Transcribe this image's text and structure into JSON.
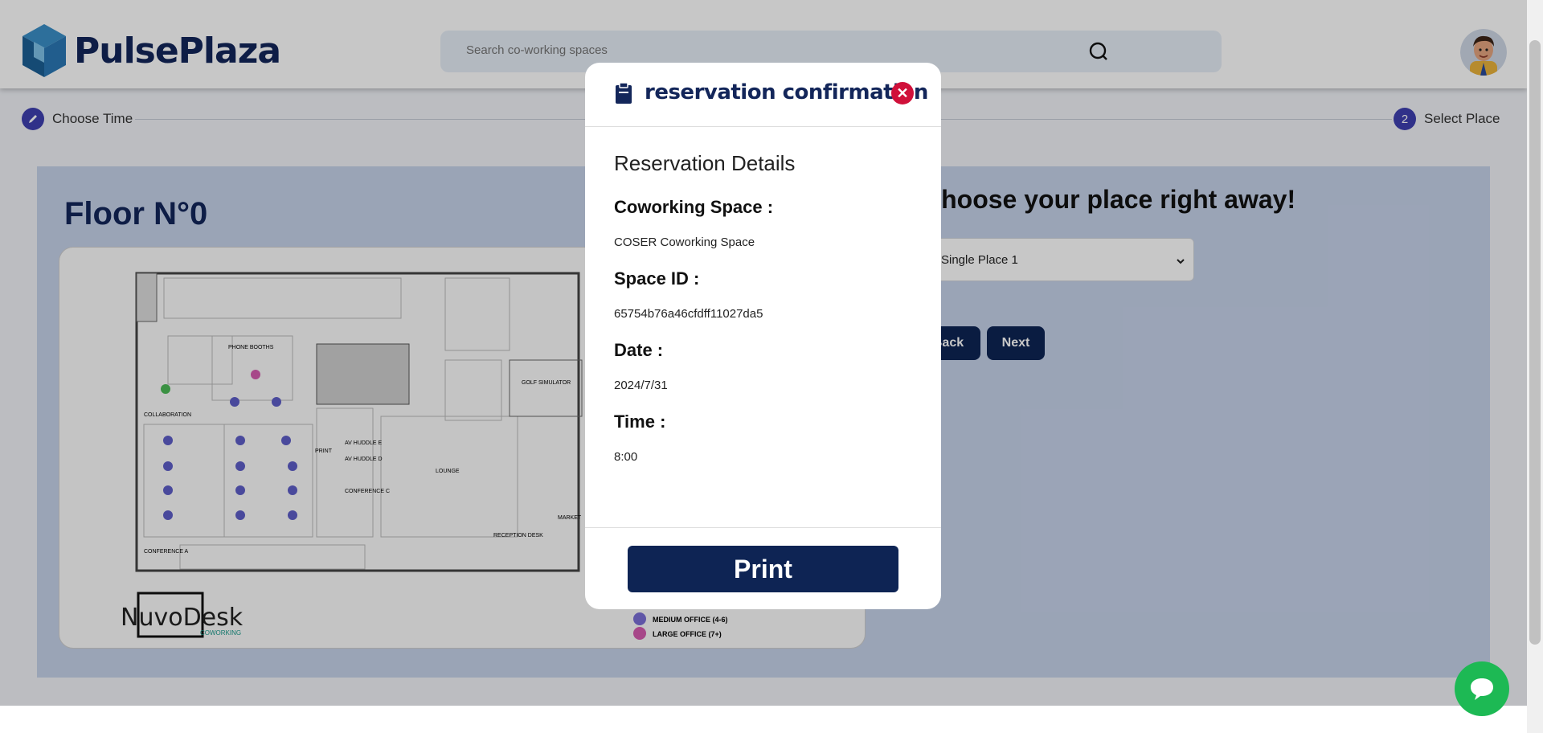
{
  "header": {
    "brand": "PulsePlaza",
    "search_placeholder": "Search co-working spaces"
  },
  "stepper": {
    "steps": [
      {
        "label": "Choose Time",
        "icon": "pencil-icon"
      },
      {
        "number": "2",
        "label": "Select Place"
      }
    ]
  },
  "main": {
    "floor_title": "Floor N°0",
    "choose_heading": "Choose your place right away!",
    "select_value": "Single Place 1",
    "back_label": "Back",
    "next_label": "Next"
  },
  "floorplan": {
    "labels": [
      "PHONE BOOTHS",
      "COLLABORATION",
      "PRINT",
      "AV HUDDLE E",
      "AV HUDDLE D",
      "CONFERENCE C",
      "CONFERENCE A",
      "LOUNGE",
      "RECEPTION DESK",
      "GOLF SIMULATOR",
      "MARKET"
    ],
    "logo_text": "NuvoDesk",
    "logo_sub": "COWORKING",
    "legend": [
      {
        "label": "MEDIUM OFFICE (4-6)",
        "color": "#7a6fd6"
      },
      {
        "label": "LARGE OFFICE (7+)",
        "color": "#d65bb0"
      }
    ]
  },
  "modal": {
    "title": "reservation confirmation",
    "details_heading": "Reservation Details",
    "fields": [
      {
        "label": "Coworking Space :",
        "value": "COSER Coworking Space"
      },
      {
        "label": "Space ID :",
        "value": "65754b76a46cfdff11027da5"
      },
      {
        "label": "Date :",
        "value": "2024/7/31"
      },
      {
        "label": "Time :",
        "value": "8:00"
      }
    ],
    "print_label": "Print"
  },
  "colors": {
    "primary": "#0e2454",
    "accent": "#3e3fb0",
    "close": "#d0103a",
    "chat": "#1db954"
  }
}
